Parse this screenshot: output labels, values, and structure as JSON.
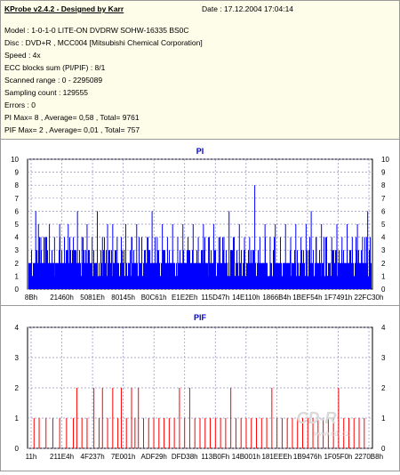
{
  "header": {
    "app_title": "KProbe v2.4.2 - Designed by Karr",
    "date": "Date : 17.12.2004 17:04:14",
    "lines": [
      "Model : 1-0-1-0 LITE-ON DVDRW SOHW-16335 BS0C",
      "Disc : DVD+R , MCC004 [Mitsubishi Chemical Corporation]",
      "Speed : 4x",
      "ECC blocks sum (PI/PIF) : 8/1",
      "Scanned range : 0 - 2295089",
      "Sampling count : 129555",
      "Errors : 0",
      "PI Max= 8 , Average= 0,58 , Total= 9761",
      "PIF Max= 2 , Average= 0,01 , Total= 757"
    ]
  },
  "watermark": {
    "text": "CD-R",
    "url": "www.cdr.cz"
  },
  "chart_data": [
    {
      "type": "bar",
      "title": "PI",
      "ylim": [
        0,
        10
      ],
      "yticks": [
        0,
        1,
        2,
        3,
        4,
        5,
        6,
        7,
        8,
        9,
        10
      ],
      "xticks": [
        "8Bh",
        "21460h",
        "5081Eh",
        "80145h",
        "B0C61h",
        "E1E2Eh",
        "115D47h",
        "14E110h",
        "1866B4h",
        "1BEF54h",
        "1F7491h",
        "22FC30h"
      ],
      "grid": true,
      "colors": {
        "series": "#0000ff",
        "axis_title": "#0000cc",
        "grid": "#9090c0"
      },
      "summary": {
        "max": 8,
        "average": 0.58,
        "total": 9761
      },
      "spikes": [
        [
          0.02,
          6
        ],
        [
          0.028,
          5
        ],
        [
          0.035,
          4
        ],
        [
          0.048,
          4
        ],
        [
          0.06,
          5
        ],
        [
          0.075,
          4
        ],
        [
          0.09,
          5
        ],
        [
          0.104,
          4
        ],
        [
          0.115,
          5
        ],
        [
          0.13,
          4
        ],
        [
          0.142,
          6
        ],
        [
          0.155,
          4
        ],
        [
          0.17,
          5
        ],
        [
          0.185,
          4
        ],
        [
          0.2,
          6
        ],
        [
          0.215,
          4
        ],
        [
          0.23,
          5
        ],
        [
          0.245,
          5
        ],
        [
          0.258,
          4
        ],
        [
          0.27,
          4
        ],
        [
          0.283,
          5
        ],
        [
          0.3,
          4
        ],
        [
          0.315,
          5
        ],
        [
          0.33,
          4
        ],
        [
          0.346,
          4
        ],
        [
          0.36,
          6
        ],
        [
          0.375,
          4
        ],
        [
          0.39,
          5
        ],
        [
          0.405,
          4
        ],
        [
          0.42,
          5
        ],
        [
          0.435,
          4
        ],
        [
          0.45,
          5
        ],
        [
          0.465,
          4
        ],
        [
          0.48,
          5
        ],
        [
          0.495,
          4
        ],
        [
          0.51,
          5
        ],
        [
          0.525,
          4
        ],
        [
          0.54,
          5
        ],
        [
          0.555,
          4
        ],
        [
          0.57,
          4
        ],
        [
          0.585,
          6
        ],
        [
          0.6,
          4
        ],
        [
          0.615,
          5
        ],
        [
          0.63,
          4
        ],
        [
          0.645,
          4
        ],
        [
          0.66,
          8
        ],
        [
          0.675,
          4
        ],
        [
          0.69,
          5
        ],
        [
          0.705,
          4
        ],
        [
          0.72,
          5
        ],
        [
          0.735,
          4
        ],
        [
          0.75,
          5
        ],
        [
          0.765,
          4
        ],
        [
          0.78,
          5
        ],
        [
          0.795,
          4
        ],
        [
          0.81,
          5
        ],
        [
          0.825,
          6
        ],
        [
          0.84,
          4
        ],
        [
          0.855,
          5
        ],
        [
          0.87,
          4
        ],
        [
          0.885,
          4
        ],
        [
          0.9,
          5
        ],
        [
          0.915,
          4
        ],
        [
          0.93,
          5
        ],
        [
          0.945,
          4
        ],
        [
          0.96,
          5
        ],
        [
          0.975,
          4
        ],
        [
          0.99,
          6
        ]
      ]
    },
    {
      "type": "bar",
      "title": "PIF",
      "ylim": [
        0,
        4
      ],
      "yticks": [
        0,
        1,
        2,
        3,
        4
      ],
      "xticks": [
        "11h",
        "211E4h",
        "4F237h",
        "7E001h",
        "ADF29h",
        "DFD38h",
        "113B0Fh",
        "14B001h",
        "181EEEh",
        "1B9476h",
        "1F05F0h",
        "2270B8h"
      ],
      "grid": true,
      "colors": {
        "series": "#ff0000",
        "axis_title": "#0000cc",
        "grid": "#9090c0"
      },
      "summary": {
        "max": 2,
        "average": 0.01,
        "total": 757
      },
      "spikes": [
        [
          0.015,
          1
        ],
        [
          0.03,
          1
        ],
        [
          0.05,
          1
        ],
        [
          0.07,
          1
        ],
        [
          0.09,
          1
        ],
        [
          0.11,
          1
        ],
        [
          0.13,
          1
        ],
        [
          0.14,
          2
        ],
        [
          0.155,
          1
        ],
        [
          0.17,
          1
        ],
        [
          0.19,
          2
        ],
        [
          0.205,
          1
        ],
        [
          0.215,
          2
        ],
        [
          0.23,
          1
        ],
        [
          0.245,
          2
        ],
        [
          0.26,
          1
        ],
        [
          0.27,
          2
        ],
        [
          0.285,
          1
        ],
        [
          0.3,
          2
        ],
        [
          0.31,
          1
        ],
        [
          0.32,
          2
        ],
        [
          0.335,
          1
        ],
        [
          0.35,
          1
        ],
        [
          0.365,
          1
        ],
        [
          0.38,
          1
        ],
        [
          0.395,
          1
        ],
        [
          0.41,
          1
        ],
        [
          0.425,
          1
        ],
        [
          0.44,
          2
        ],
        [
          0.455,
          1
        ],
        [
          0.47,
          2
        ],
        [
          0.485,
          1
        ],
        [
          0.5,
          1
        ],
        [
          0.515,
          1
        ],
        [
          0.53,
          1
        ],
        [
          0.545,
          1
        ],
        [
          0.56,
          1
        ],
        [
          0.575,
          1
        ],
        [
          0.59,
          2
        ],
        [
          0.605,
          1
        ],
        [
          0.62,
          1
        ],
        [
          0.635,
          1
        ],
        [
          0.65,
          1
        ],
        [
          0.665,
          1
        ],
        [
          0.68,
          1
        ],
        [
          0.695,
          1
        ],
        [
          0.71,
          2
        ],
        [
          0.725,
          1
        ],
        [
          0.74,
          1
        ],
        [
          0.755,
          1
        ],
        [
          0.77,
          1
        ],
        [
          0.785,
          1
        ],
        [
          0.8,
          1
        ],
        [
          0.815,
          1
        ],
        [
          0.83,
          1
        ],
        [
          0.845,
          1
        ],
        [
          0.86,
          1
        ],
        [
          0.875,
          1
        ],
        [
          0.89,
          1
        ],
        [
          0.905,
          2
        ],
        [
          0.92,
          1
        ],
        [
          0.935,
          1
        ],
        [
          0.95,
          1
        ],
        [
          0.965,
          1
        ],
        [
          0.98,
          1
        ]
      ]
    }
  ]
}
